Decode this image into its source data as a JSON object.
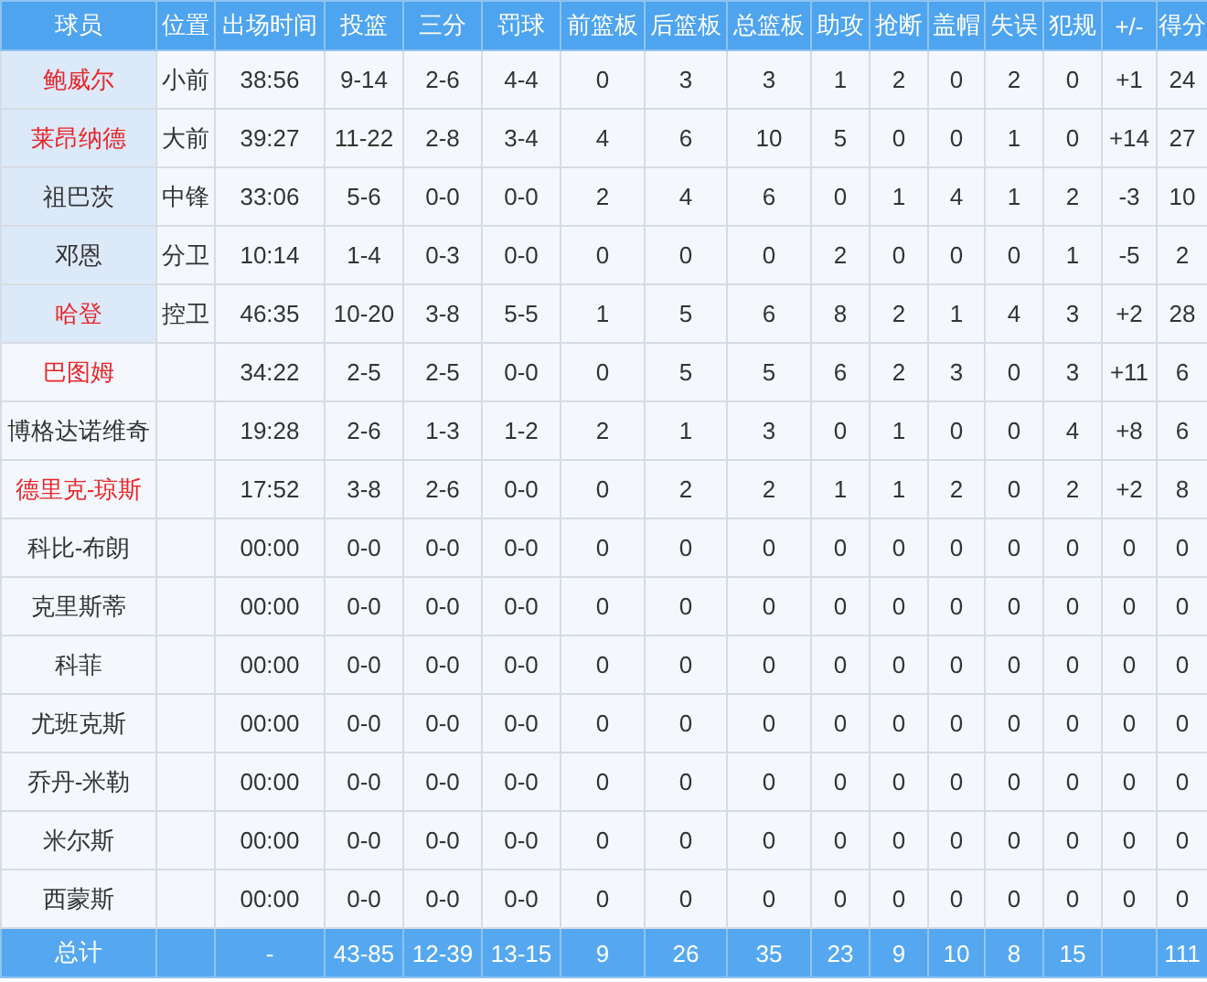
{
  "table": {
    "columns": [
      "球员",
      "位置",
      "出场时间",
      "投篮",
      "三分",
      "罚球",
      "前篮板",
      "后篮板",
      "总篮板",
      "助攻",
      "抢断",
      "盖帽",
      "失误",
      "犯规",
      "+/-",
      "得分"
    ],
    "rows": [
      {
        "player": "鲍威尔",
        "highlight": true,
        "starter": true,
        "position": "小前",
        "stats": [
          "38:56",
          "9-14",
          "2-6",
          "4-4",
          "0",
          "3",
          "3",
          "1",
          "2",
          "0",
          "2",
          "0",
          "+1",
          "24"
        ]
      },
      {
        "player": "莱昂纳德",
        "highlight": true,
        "starter": true,
        "position": "大前",
        "stats": [
          "39:27",
          "11-22",
          "2-8",
          "3-4",
          "4",
          "6",
          "10",
          "5",
          "0",
          "0",
          "1",
          "0",
          "+14",
          "27"
        ]
      },
      {
        "player": "祖巴茨",
        "highlight": false,
        "starter": true,
        "position": "中锋",
        "stats": [
          "33:06",
          "5-6",
          "0-0",
          "0-0",
          "2",
          "4",
          "6",
          "0",
          "1",
          "4",
          "1",
          "2",
          "-3",
          "10"
        ]
      },
      {
        "player": "邓恩",
        "highlight": false,
        "starter": true,
        "position": "分卫",
        "stats": [
          "10:14",
          "1-4",
          "0-3",
          "0-0",
          "0",
          "0",
          "0",
          "2",
          "0",
          "0",
          "0",
          "1",
          "-5",
          "2"
        ]
      },
      {
        "player": "哈登",
        "highlight": true,
        "starter": true,
        "position": "控卫",
        "stats": [
          "46:35",
          "10-20",
          "3-8",
          "5-5",
          "1",
          "5",
          "6",
          "8",
          "2",
          "1",
          "4",
          "3",
          "+2",
          "28"
        ]
      },
      {
        "player": "巴图姆",
        "highlight": true,
        "starter": false,
        "stats": [
          "34:22",
          "2-5",
          "2-5",
          "0-0",
          "0",
          "5",
          "5",
          "6",
          "2",
          "3",
          "0",
          "3",
          "+11",
          "6"
        ]
      },
      {
        "player": "博格达诺维奇",
        "highlight": false,
        "starter": false,
        "stats": [
          "19:28",
          "2-6",
          "1-3",
          "1-2",
          "2",
          "1",
          "3",
          "0",
          "1",
          "0",
          "0",
          "4",
          "+8",
          "6"
        ]
      },
      {
        "player": "德里克-琼斯",
        "highlight": true,
        "starter": false,
        "stats": [
          "17:52",
          "3-8",
          "2-6",
          "0-0",
          "0",
          "2",
          "2",
          "1",
          "1",
          "2",
          "0",
          "2",
          "+2",
          "8"
        ]
      },
      {
        "player": "科比-布朗",
        "highlight": false,
        "starter": false,
        "stats": [
          "00:00",
          "0-0",
          "0-0",
          "0-0",
          "0",
          "0",
          "0",
          "0",
          "0",
          "0",
          "0",
          "0",
          "0",
          "0"
        ]
      },
      {
        "player": "克里斯蒂",
        "highlight": false,
        "starter": false,
        "stats": [
          "00:00",
          "0-0",
          "0-0",
          "0-0",
          "0",
          "0",
          "0",
          "0",
          "0",
          "0",
          "0",
          "0",
          "0",
          "0"
        ]
      },
      {
        "player": "科菲",
        "highlight": false,
        "starter": false,
        "stats": [
          "00:00",
          "0-0",
          "0-0",
          "0-0",
          "0",
          "0",
          "0",
          "0",
          "0",
          "0",
          "0",
          "0",
          "0",
          "0"
        ]
      },
      {
        "player": "尤班克斯",
        "highlight": false,
        "starter": false,
        "stats": [
          "00:00",
          "0-0",
          "0-0",
          "0-0",
          "0",
          "0",
          "0",
          "0",
          "0",
          "0",
          "0",
          "0",
          "0",
          "0"
        ]
      },
      {
        "player": "乔丹-米勒",
        "highlight": false,
        "starter": false,
        "stats": [
          "00:00",
          "0-0",
          "0-0",
          "0-0",
          "0",
          "0",
          "0",
          "0",
          "0",
          "0",
          "0",
          "0",
          "0",
          "0"
        ]
      },
      {
        "player": "米尔斯",
        "highlight": false,
        "starter": false,
        "stats": [
          "00:00",
          "0-0",
          "0-0",
          "0-0",
          "0",
          "0",
          "0",
          "0",
          "0",
          "0",
          "0",
          "0",
          "0",
          "0"
        ]
      },
      {
        "player": "西蒙斯",
        "highlight": false,
        "starter": false,
        "stats": [
          "00:00",
          "0-0",
          "0-0",
          "0-0",
          "0",
          "0",
          "0",
          "0",
          "0",
          "0",
          "0",
          "0",
          "0",
          "0"
        ]
      }
    ],
    "totals": {
      "label": "总计",
      "stats": [
        "-",
        "43-85",
        "12-39",
        "13-15",
        "9",
        "26",
        "35",
        "23",
        "9",
        "10",
        "8",
        "15"
      ],
      "points": "111"
    }
  }
}
